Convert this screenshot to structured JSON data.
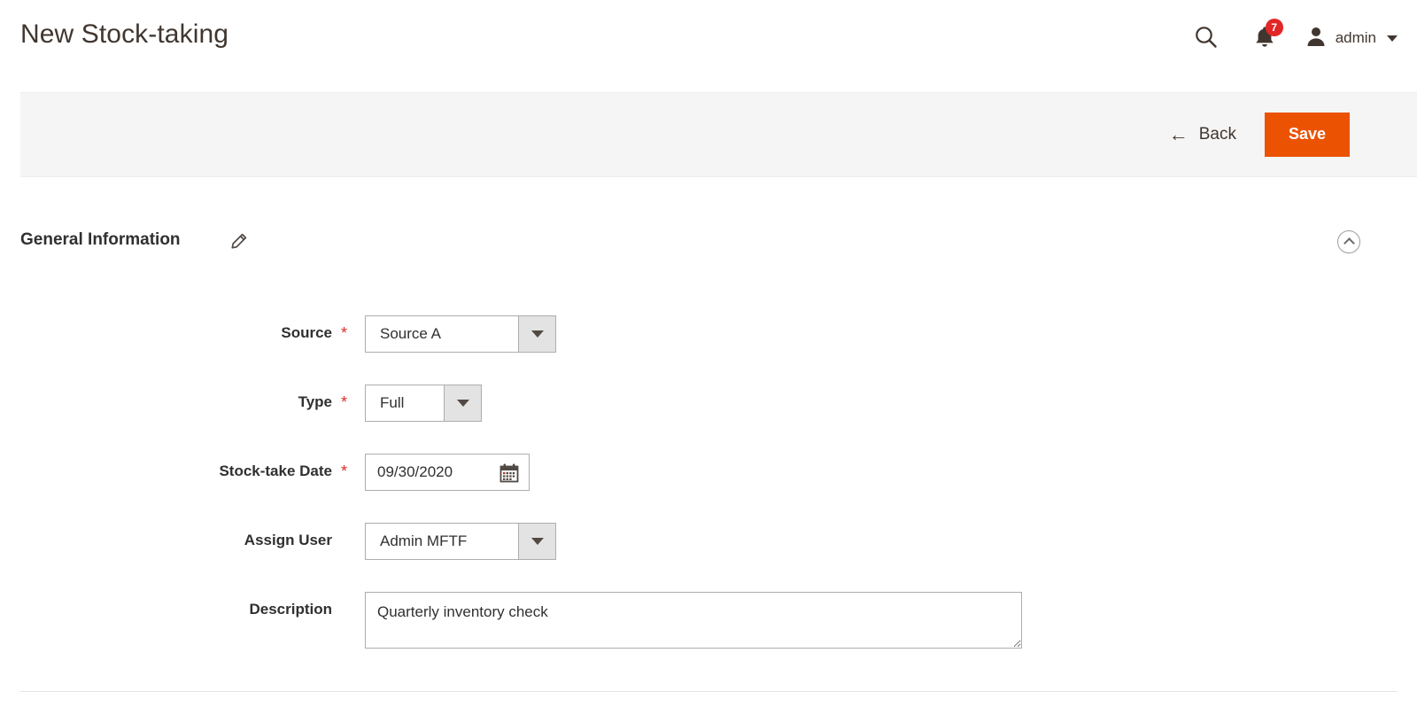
{
  "header": {
    "title": "New Stock-taking",
    "search_icon": "search-icon",
    "notifications": {
      "icon": "bell-icon",
      "count": "7"
    },
    "user": {
      "avatar_icon": "user-avatar-icon",
      "name": "admin",
      "caret_icon": "chevron-down-icon"
    }
  },
  "actions": {
    "back_label": "Back",
    "back_icon": "arrow-left-icon",
    "save_label": "Save"
  },
  "section": {
    "title": "General Information",
    "edit_icon": "pencil-icon",
    "collapse_icon": "chevron-up-circle-icon"
  },
  "fields": {
    "source": {
      "label": "Source",
      "required": "*",
      "value": "Source A",
      "arrow_icon": "chevron-down-icon"
    },
    "type": {
      "label": "Type",
      "required": "*",
      "value": "Full",
      "arrow_icon": "chevron-down-icon"
    },
    "stock_take_date": {
      "label": "Stock-take Date",
      "required": "*",
      "value": "09/30/2020",
      "calendar_icon": "calendar-icon"
    },
    "assign_user": {
      "label": "Assign User",
      "value": "Admin MFTF",
      "arrow_icon": "chevron-down-icon"
    },
    "description": {
      "label": "Description",
      "value": "Quarterly inventory check",
      "placeholder": ""
    }
  },
  "colors": {
    "accent_orange": "#eb5202",
    "badge_red": "#e22626",
    "required_red": "#e02b27",
    "actionbar_gray": "#f5f5f5"
  }
}
